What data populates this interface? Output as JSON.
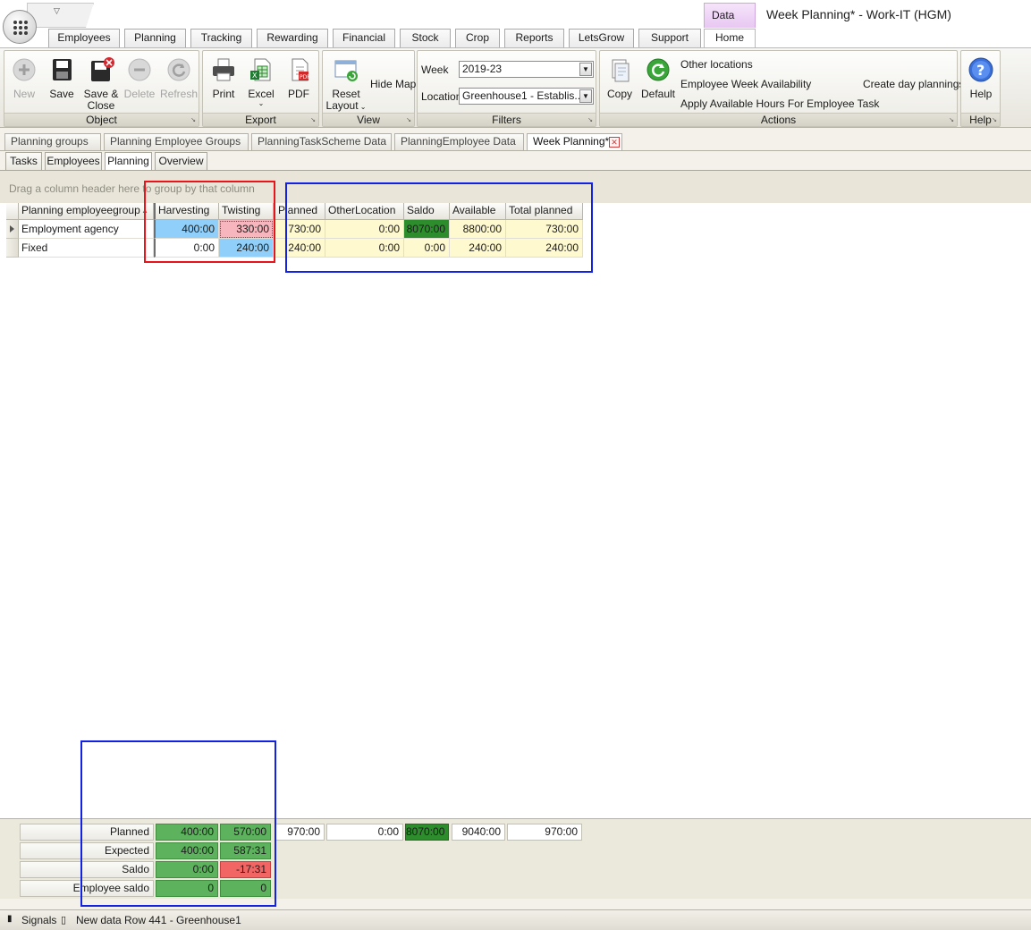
{
  "window": {
    "title": "Week Planning* - Work-IT (HGM)",
    "context_tab": "Data"
  },
  "ribbon_tabs": [
    "Employees",
    "Planning",
    "Tracking",
    "Rewarding",
    "Financial",
    "Stock",
    "Crop",
    "Reports",
    "LetsGrow",
    "Support",
    "Home"
  ],
  "ribbon": {
    "object": {
      "caption": "Object",
      "new": "New",
      "save": "Save",
      "save_close_1": "Save &",
      "save_close_2": "Close",
      "delete": "Delete",
      "refresh": "Refresh"
    },
    "export": {
      "caption": "Export",
      "print": "Print",
      "excel": "Excel",
      "pdf": "PDF"
    },
    "view": {
      "caption": "View",
      "reset_1": "Reset",
      "reset_2": "Layout",
      "hide_map": "Hide Map"
    },
    "filters": {
      "caption": "Filters",
      "week_label": "Week",
      "week_value": "2019-23",
      "location_label": "Location",
      "location_value": "Greenhouse1 - Establis..."
    },
    "actions": {
      "caption": "Actions",
      "copy": "Copy",
      "default": "Default",
      "other_locations": "Other locations",
      "employee_week_availability": "Employee Week Availability",
      "apply_hours": "Apply Available Hours For Employee Task",
      "create_day_plannings": "Create day plannings"
    },
    "help": {
      "caption": "Help",
      "help": "Help"
    }
  },
  "doc_tabs": [
    "Planning groups",
    "Planning Employee Groups",
    "PlanningTaskScheme Data",
    "PlanningEmployee Data",
    "Week Planning*"
  ],
  "sub_tabs": [
    "Tasks",
    "Employees",
    "Planning",
    "Overview"
  ],
  "grid": {
    "group_hint": "Drag a column header here to group by that column",
    "columns": [
      "Planning employeegroup",
      "Harvesting",
      "Twisting",
      "Planned",
      "OtherLocation",
      "Saldo",
      "Available",
      "Total planned"
    ],
    "rows": [
      [
        "Employment agency",
        "400:00",
        "330:00",
        "730:00",
        "0:00",
        "8070:00",
        "8800:00",
        "730:00"
      ],
      [
        "Fixed",
        "0:00",
        "240:00",
        "240:00",
        "0:00",
        "0:00",
        "240:00",
        "240:00"
      ]
    ]
  },
  "summary": {
    "labels": [
      "Planned",
      "Expected",
      "Saldo",
      "Employee saldo"
    ],
    "planned": [
      "400:00",
      "570:00",
      "970:00",
      "0:00",
      "8070:00",
      "9040:00",
      "970:00"
    ],
    "expected": [
      "400:00",
      "587:31"
    ],
    "saldo": [
      "0:00",
      "-17:31"
    ],
    "employee_saldo": [
      "0",
      "0"
    ]
  },
  "status": {
    "signals": "Signals",
    "new_data": "New data",
    "row_info": "Row 441 - Greenhouse1"
  },
  "colors": {
    "annotation_red": "#e8141c",
    "annotation_blue": "#1222e0",
    "cell_yellow": "#fff9cf",
    "cell_blue": "#8fcff9",
    "cell_pink": "#f7b6bd",
    "green": "#5db35d",
    "dark_green": "#2d8d2d",
    "red": "#f26565"
  }
}
